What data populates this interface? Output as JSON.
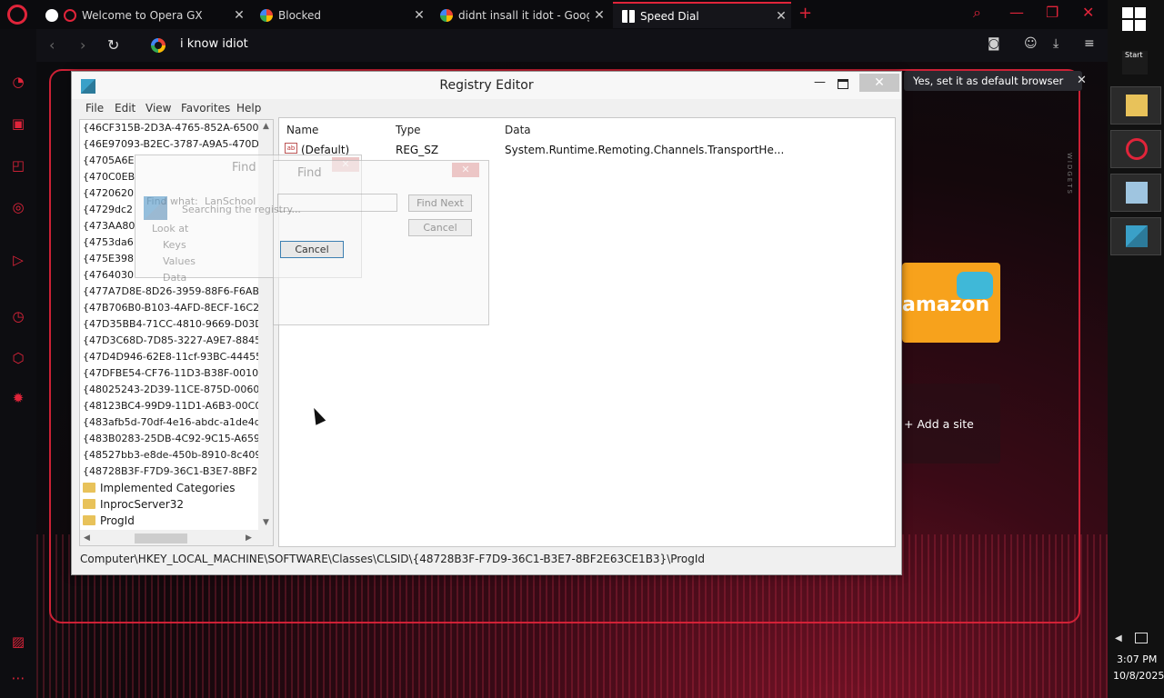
{
  "browser": {
    "tabs": [
      {
        "title": "Welcome to Opera GX",
        "close": "✕"
      },
      {
        "title": "Blocked",
        "close": "✕"
      },
      {
        "title": "didnt insall it idot - Google",
        "close": "✕"
      },
      {
        "title": "Speed Dial",
        "close": "✕"
      }
    ],
    "new_tab": "+",
    "address": "i know idiot",
    "default_banner": "Yes, set it as default browser",
    "banner_close": "✕",
    "widgets_label": "WIDGETS",
    "speed_dial": {
      "amazon_label": "amazon",
      "add_site_label": "+ Add a site"
    }
  },
  "regedit": {
    "title": "Registry Editor",
    "close": "✕",
    "minimize": "—",
    "menu": [
      "File",
      "Edit",
      "View",
      "Favorites",
      "Help"
    ],
    "tree_guids": [
      "{46CF315B-2D3A-4765-852A-6500C4...",
      "{46E97093-B2EC-3787-A9A5-470D1A...",
      "{4705A6E",
      "{470C0EB",
      "{4720620",
      "{4729dc2",
      "{473AA80",
      "{4753da6",
      "{475E398",
      "{4764030",
      "{477A7D8E-8D26-3959-88F6-F6AB7E...",
      "{47B706B0-B103-4AFD-8ECF-16C2DC...",
      "{47D35BB4-71CC-4810-9669-D03D9F...",
      "{47D3C68D-7D85-3227-A9E7-88451D...",
      "{47D4D946-62E8-11cf-93BC-4445535...",
      "{47DFBE54-CF76-11D3-B38F-00105A...",
      "{48025243-2D39-11CE-875D-00608CE...",
      "{48123BC4-99D9-11D1-A6B3-00C04F...",
      "{483afb5d-70df-4e16-abdc-a1de4d0...",
      "{483B0283-25DB-4C92-9C15-A65925...",
      "{48527bb3-e8de-450b-8910-8c4099c...",
      "{48728B3F-F7D9-36C1-B3E7-8BF2E63..."
    ],
    "tree_folders": [
      "Implemented Categories",
      "InprocServer32",
      "ProgId"
    ],
    "columns": {
      "name": "Name",
      "type": "Type",
      "data": "Data"
    },
    "row": {
      "name": "(Default)",
      "type": "REG_SZ",
      "data": "System.Runtime.Remoting.Channels.TransportHe..."
    },
    "status_path": "Computer\\HKEY_LOCAL_MACHINE\\SOFTWARE\\Classes\\CLSID\\{48728B3F-F7D9-36C1-B3E7-8BF2E63CE1B3}\\ProgId"
  },
  "find_dialog": {
    "title": "Find",
    "find_next": "Find Next",
    "cancel": "Cancel",
    "searching": "Searching the registry...",
    "find_what_label": "Find what:",
    "find_what_value": "LanSchool",
    "look_at": "Look at",
    "check_keys": "Keys",
    "check_values": "Values",
    "check_data": "Data"
  },
  "taskbar": {
    "start_label": "Start",
    "time": "3:07 PM",
    "date": "10/8/2025"
  },
  "colors": {
    "opera_red": "#e0243a",
    "amazon_orange": "#f7a21c"
  }
}
